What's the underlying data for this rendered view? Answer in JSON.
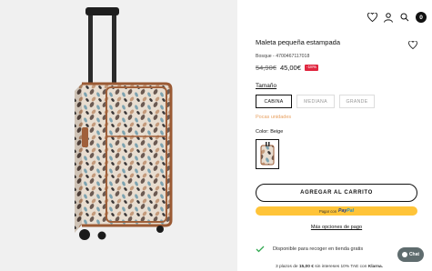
{
  "header": {
    "icons": [
      "heart-icon",
      "user-icon",
      "search-icon",
      "cart-icon"
    ],
    "cart_count": "0"
  },
  "product": {
    "title": "Maleta pequeña estampada",
    "reference": "Bosque - 4700467117018",
    "old_price": "54,90€",
    "new_price": "45,00€",
    "discount": "-18%"
  },
  "size": {
    "label": "Tamaño",
    "options": [
      "CABINA",
      "MEDIANA",
      "GRANDE"
    ],
    "selected": "CABINA",
    "stock_note": "Pocas unidades"
  },
  "color": {
    "label": "Color:",
    "value": "Beige"
  },
  "actions": {
    "add_to_cart": "AGREGAR AL CARRITO",
    "paypal_prefix": "Pagar con",
    "paypal_brand_a": "Pay",
    "paypal_brand_b": "Pal",
    "more_payment": "Más opciones de pago"
  },
  "pickup": {
    "text": "Disponible para recoger en tienda gratis"
  },
  "chat": {
    "label": "Chat"
  },
  "klarna": {
    "prefix": "3 plazos de",
    "amount": "15,00 €",
    "middle": "sin intereses 10% TAE con",
    "brand": "Klarna."
  },
  "colors": {
    "discount_bg": "#e0263f",
    "stock_text": "#e8a060",
    "paypal_bg": "#ffc439",
    "check_green": "#2fa84f",
    "chat_bg": "#5f6c6e"
  }
}
